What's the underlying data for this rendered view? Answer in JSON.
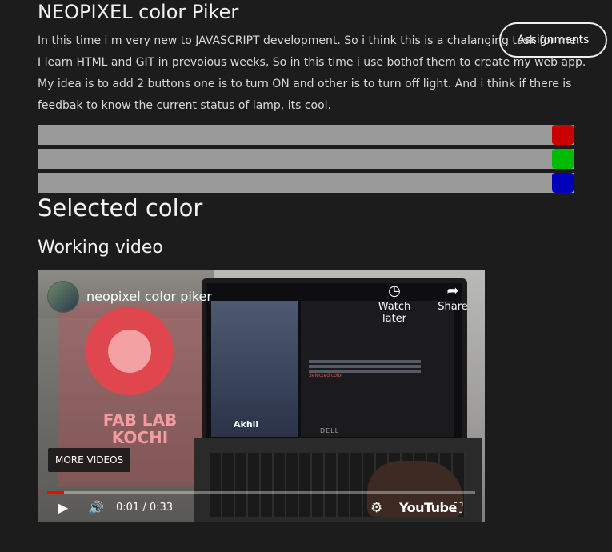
{
  "header": {
    "title": "NEOPIXEL color Piker",
    "assignments_label": "Assignments"
  },
  "intro": {
    "lines": [
      "In this time i m very new to JAVASCRIPT development. So i think this is a chalanging task for me.",
      "I learn HTML and GIT in prevoious weeks, So in this time i use bothof them to create my web app.",
      "My idea is to add 2 buttons one is to turn ON and other is to turn off light. And i think if there is",
      "feedbak to know the current status of lamp, its cool."
    ]
  },
  "sliders": [
    {
      "name": "red",
      "color": "#cc0000",
      "value": 1.0
    },
    {
      "name": "green",
      "color": "#00bb00",
      "value": 1.0
    },
    {
      "name": "blue",
      "color": "#0000bb",
      "value": 1.0
    }
  ],
  "selected_color_label": "Selected color",
  "video_heading": "Working video",
  "video": {
    "title": "neopixel color piker",
    "watch_later": "Watch later",
    "share": "Share",
    "more_videos": "MORE VIDEOS",
    "time": "0:01 / 0:33",
    "progress": 0.04,
    "brand": "YouTube",
    "sign_lines": [
      "FAB LAB",
      "KOCHI"
    ],
    "screen_name": "Akhil",
    "screen_selected_color": "Selected color",
    "screen_brand": "DELL"
  }
}
